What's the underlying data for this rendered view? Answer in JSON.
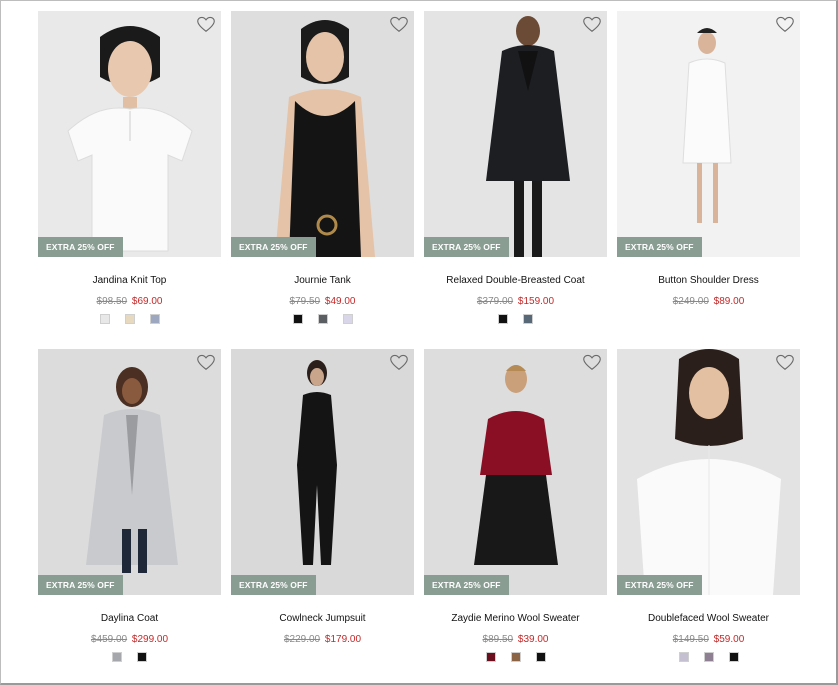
{
  "products": [
    {
      "name": "Jandina Knit Top",
      "old_price": "$98.50",
      "new_price": "$69.00",
      "promo": "EXTRA 25% OFF",
      "swatches": [
        "#e8e8e8",
        "#e7d9bf",
        "#9ea7c0"
      ],
      "image": "white-top"
    },
    {
      "name": "Journie Tank",
      "old_price": "$79.50",
      "new_price": "$49.00",
      "promo": "EXTRA 25% OFF",
      "swatches": [
        "#111111",
        "#5b5e63",
        "#d8d6e8"
      ],
      "image": "black-tank"
    },
    {
      "name": "Relaxed Double-Breasted Coat",
      "old_price": "$379.00",
      "new_price": "$159.00",
      "promo": "EXTRA 25% OFF",
      "swatches": [
        "#111111",
        "#596876"
      ],
      "image": "black-coat"
    },
    {
      "name": "Button Shoulder Dress",
      "old_price": "$249.00",
      "new_price": "$89.00",
      "promo": "EXTRA 25% OFF",
      "swatches": [],
      "image": "white-dress"
    },
    {
      "name": "Daylina Coat",
      "old_price": "$459.00",
      "new_price": "$299.00",
      "promo": "EXTRA 25% OFF",
      "swatches": [
        "#a5a7ad",
        "#111111"
      ],
      "image": "grey-coat"
    },
    {
      "name": "Cowlneck Jumpsuit",
      "old_price": "$229.00",
      "new_price": "$179.00",
      "promo": "EXTRA 25% OFF",
      "swatches": [],
      "image": "black-jumpsuit"
    },
    {
      "name": "Zaydie Merino Wool Sweater",
      "old_price": "$89.50",
      "new_price": "$39.00",
      "promo": "EXTRA 25% OFF",
      "swatches": [
        "#6b0f1e",
        "#8a6444",
        "#111111"
      ],
      "image": "red-sweater"
    },
    {
      "name": "Doublefaced Wool Sweater",
      "old_price": "$149.50",
      "new_price": "$59.00",
      "promo": "EXTRA 25% OFF",
      "swatches": [
        "#c4c0d2",
        "#8f7f92",
        "#111111"
      ],
      "image": "white-sweater"
    }
  ],
  "colors": {
    "promo_bg": "#8a9d92",
    "sale_price": "#c62828",
    "old_price": "#8a8a8a"
  },
  "icons": {
    "wishlist": "heart-outline-icon"
  }
}
